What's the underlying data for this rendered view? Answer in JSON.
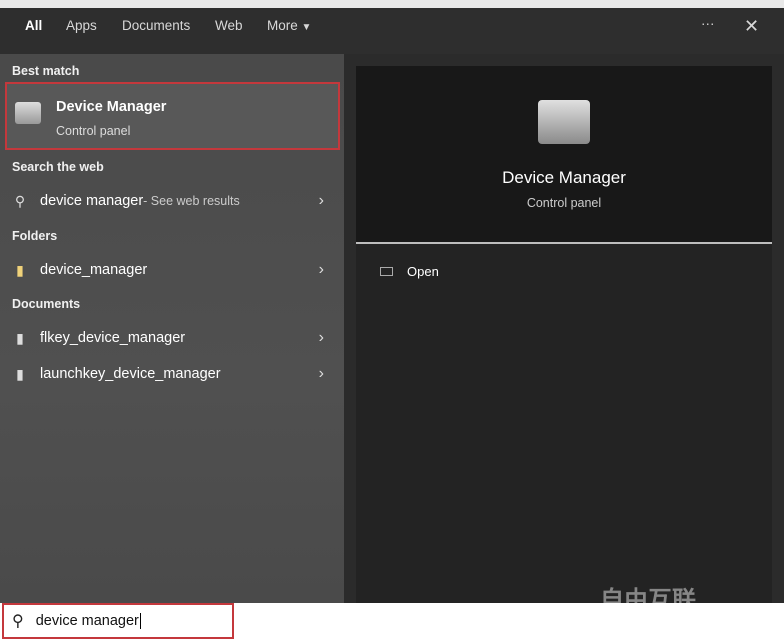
{
  "tabs": [
    "All",
    "Apps",
    "Documents",
    "Web",
    "More"
  ],
  "more_menu_label": "···",
  "close_label": "✕",
  "sections": {
    "best_match": "Best match",
    "search_web": "Search the web",
    "folders": "Folders",
    "documents": "Documents"
  },
  "best_match": {
    "title": "Device Manager",
    "subtitle": "Control panel"
  },
  "web_result": {
    "query": "device manager",
    "suffix": " - See web results"
  },
  "folders": [
    "device_manager"
  ],
  "documents": [
    "flkey_device_manager",
    "launchkey_device_manager"
  ],
  "preview": {
    "title": "Device Manager",
    "subtitle": "Control panel",
    "actions": [
      "Open"
    ]
  },
  "search": {
    "value": "device manager"
  },
  "watermark": "自由互联",
  "colors": {
    "highlight": "#c4383c"
  }
}
